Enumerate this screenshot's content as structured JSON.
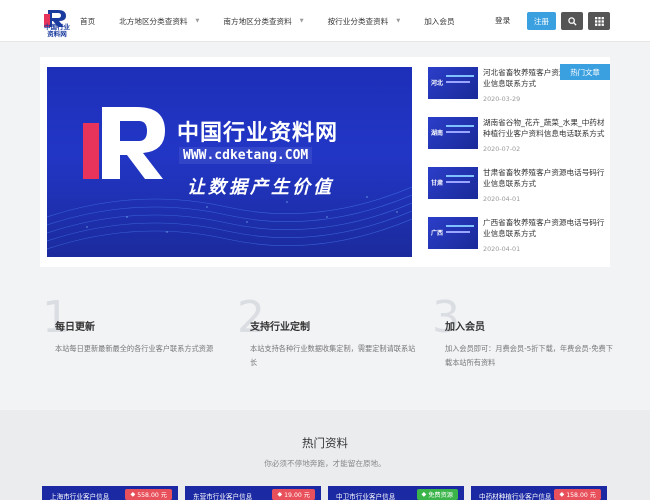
{
  "header": {
    "logo_text_line1": "中国行业",
    "logo_text_line2": "资料网",
    "nav": [
      {
        "label": "首页",
        "has_dropdown": false
      },
      {
        "label": "北方地区分类查资料",
        "has_dropdown": true
      },
      {
        "label": "南方地区分类查资料",
        "has_dropdown": true
      },
      {
        "label": "按行业分类查资料",
        "has_dropdown": true
      },
      {
        "label": "加入会员",
        "has_dropdown": false
      }
    ],
    "login_label": "登录",
    "register_label": "注册",
    "icons": {
      "search": "search-icon",
      "grid": "grid-icon",
      "caret": "chevron-down-icon"
    }
  },
  "banner": {
    "title": "中国行业资料网",
    "url": "WWW.cdketang.COM",
    "slogan": "让数据产生价值"
  },
  "hot_articles_tag": "热门文章",
  "side_articles": [
    {
      "thumb_label": "河北",
      "title": "河北省畜牧养殖客户资源电话号码行业信息联系方式",
      "date": "2020-03-29"
    },
    {
      "thumb_label": "湖南",
      "title": "湖南省谷物_花卉_蔬菜_水果_中药材种植行业客户资料信息电话联系方式",
      "date": "2020-07-02"
    },
    {
      "thumb_label": "甘肃",
      "title": "甘肃省畜牧养殖客户资源电话号码行业信息联系方式",
      "date": "2020-04-01"
    },
    {
      "thumb_label": "广西",
      "title": "广西省畜牧养殖客户资源电话号码行业信息联系方式",
      "date": "2020-04-01"
    }
  ],
  "features": [
    {
      "num": "1",
      "title": "每日更新",
      "desc": "本站每日更新最新最全的各行业客户联系方式资源"
    },
    {
      "num": "2",
      "title": "支持行业定制",
      "desc": "本站支持各种行业数据收集定制，需要定制请联系站长"
    },
    {
      "num": "3",
      "title": "加入会员",
      "desc": "加入会员即可：月费会员-5折下载，年费会员-免费下载本站所有资料"
    }
  ],
  "hot_resources": {
    "title": "热门资料",
    "subtitle": "你必须不停地奔跑，才能留在原地。",
    "cards": [
      {
        "label": "上海市行业客户信息",
        "badge": "558.00 元",
        "badge_color": "#e8505b"
      },
      {
        "label": "东营市行业客户信息",
        "badge": "19.00 元",
        "badge_color": "#e8505b"
      },
      {
        "label": "中卫市行业客户信息",
        "badge": "免费资源",
        "badge_color": "#3bb54a"
      },
      {
        "label": "中药材种植行业客户信息",
        "badge": "158.00 元",
        "badge_color": "#e8505b"
      }
    ]
  },
  "colors": {
    "accent": "#3aa0e0",
    "brand_blue": "#1b2aa3",
    "price_red": "#e8505b",
    "free_green": "#3bb54a"
  }
}
